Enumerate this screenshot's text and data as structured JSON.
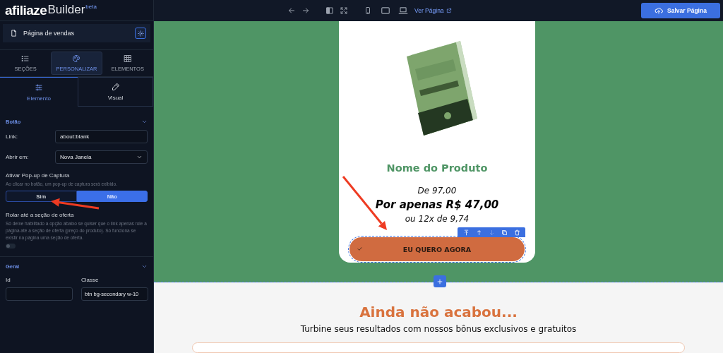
{
  "logo": {
    "brand": "afiliaze",
    "product": "Builder",
    "badge": "beta"
  },
  "page_selector": {
    "title": "Página de vendas"
  },
  "main_tabs": [
    {
      "label": "SEÇÕES",
      "kind": "list",
      "selected": false
    },
    {
      "label": "PERSONALIZAR",
      "kind": "palette",
      "selected": true
    },
    {
      "label": "ELEMENTOS",
      "kind": "grid",
      "selected": false
    }
  ],
  "sub_tabs": [
    {
      "label": "Elemento",
      "kind": "sliders",
      "selected": true
    },
    {
      "label": "Visual",
      "kind": "pencil",
      "selected": false
    }
  ],
  "button_panel": {
    "title": "Botão",
    "expanded": true,
    "link": {
      "label": "Link:",
      "value": "about:blank"
    },
    "open_in": {
      "label": "Abrir em:",
      "value": "Nova Janela"
    },
    "popup": {
      "title": "Ativar Pop-up de Captura",
      "hint": "Ao clicar no botão, um pop-up de captura será exibido.",
      "options": [
        {
          "label": "Sim",
          "selected": false
        },
        {
          "label": "Não",
          "selected": true
        }
      ]
    },
    "scroll": {
      "title": "Rolar até a seção de oferta",
      "hint": "Só deixe habilitado a opção abaixo se quiser que o link apenas role a página até a seção de oferta (preço do produto). Só funciona se existir na página uma seção de oferta.",
      "on": false
    }
  },
  "general_panel": {
    "title": "Geral",
    "expanded": true,
    "id_field": {
      "label": "Id"
    },
    "class_field": {
      "label": "Classe",
      "value": "btn bg-secondary w-10"
    }
  },
  "toolbar": {
    "tools": [
      {
        "kind": "undo"
      },
      {
        "kind": "redo"
      },
      {
        "kind": "panel"
      },
      {
        "kind": "fullscreen"
      },
      {
        "kind": "mobile"
      },
      {
        "kind": "tablet"
      },
      {
        "kind": "desktop"
      }
    ],
    "view_link": "Ver Página",
    "save_button": "Salvar Página"
  },
  "product_card": {
    "kind": "picture",
    "title": "Nome do Produto",
    "old_price": "De 97,00",
    "price": "Por apenas R$ 47,00",
    "installments": "ou 12x de 9,74",
    "element_tools": [
      {
        "kind": "move-top",
        "disabled": false
      },
      {
        "kind": "up",
        "disabled": false
      },
      {
        "kind": "down",
        "disabled": true
      },
      {
        "kind": "copy",
        "disabled": false
      },
      {
        "kind": "delete",
        "disabled": false
      }
    ],
    "cta": "EU QUERO AGORA"
  },
  "bonus_section": {
    "title": "Ainda não acabou...",
    "subtitle": "Turbine seus resultados com nossos bônus exclusivos e gratuitos"
  }
}
